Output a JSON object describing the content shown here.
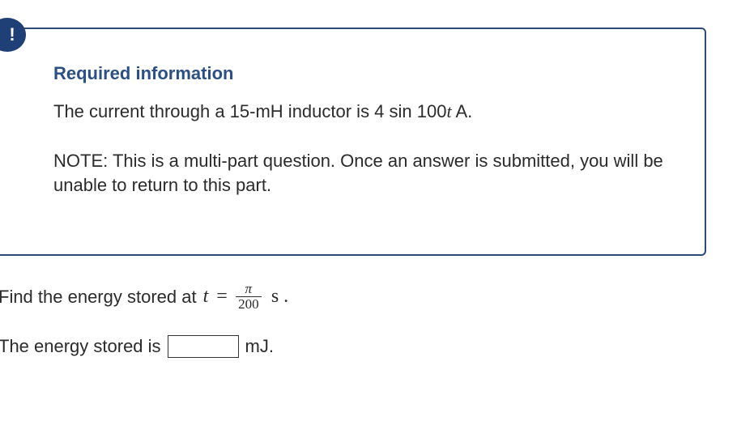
{
  "alert": {
    "icon": "exclamation-icon",
    "symbol": "!"
  },
  "required_info": {
    "title": "Required information",
    "prompt_pre": "The current through a 15-mH inductor is 4 sin 100",
    "prompt_var": "t",
    "prompt_post": " A.",
    "note": "NOTE: This is a multi-part question. Once an answer is submitted, you will be unable to return to this part."
  },
  "question": {
    "text": "Find the energy stored at",
    "variable": "t",
    "equals": "=",
    "fraction_numerator": "π",
    "fraction_denominator": "200",
    "unit": "s ."
  },
  "answer": {
    "label": "The energy stored is",
    "value": "",
    "unit": "mJ."
  }
}
